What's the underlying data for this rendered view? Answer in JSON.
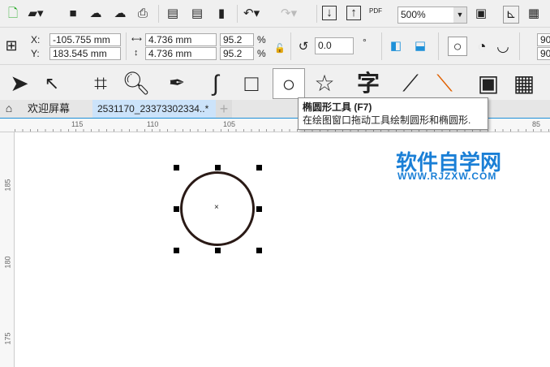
{
  "toolbar": {
    "zoom": "500%",
    "pdf_label": "PDF"
  },
  "props": {
    "x_label": "X:",
    "y_label": "Y:",
    "x": "-105.755 mm",
    "y": "183.545 mm",
    "width": "4.736 mm",
    "height": "4.736 mm",
    "scale_w": "95.2",
    "scale_h": "95.2",
    "pct": "%",
    "rotation": "0.0",
    "degree": "°",
    "angle1": "90",
    "angle2": "90"
  },
  "tabs": {
    "welcome": "欢迎屏幕",
    "document": "2531170_23373302334..*",
    "add": "+"
  },
  "tooltip": {
    "title": "椭圆形工具 (F7)",
    "description": "在绘图窗口拖动工具绘制圆形和椭圆形."
  },
  "ruler": {
    "h_ticks": [
      "115",
      "110",
      "105",
      "85"
    ],
    "v_ticks": [
      "185",
      "180",
      "175"
    ]
  },
  "watermark": {
    "title": "软件自学网",
    "url": "WWW.RJZXW.COM"
  },
  "colors": {
    "accent": "#1e90d8",
    "watermark": "#1a7fd6",
    "selection": "#000000"
  }
}
